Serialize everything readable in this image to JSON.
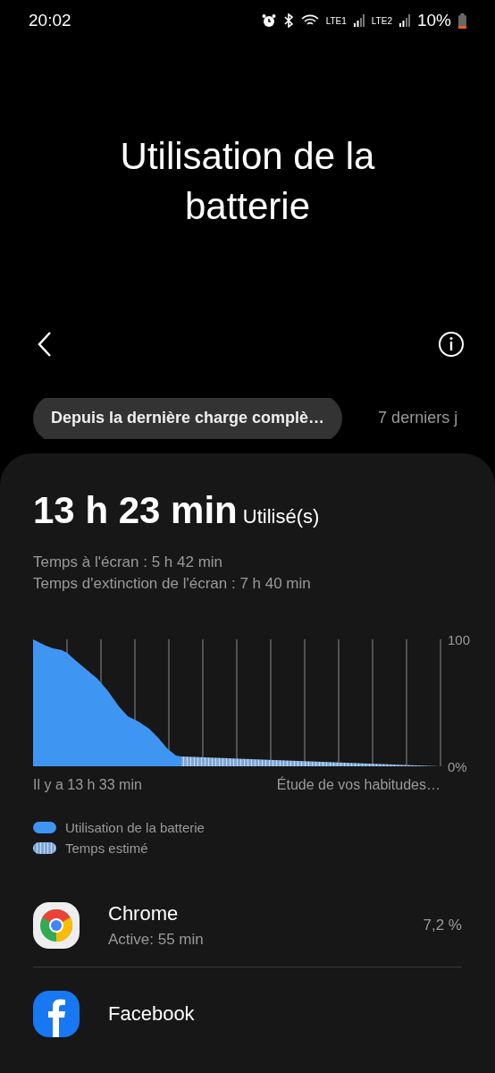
{
  "status_bar": {
    "time": "20:02",
    "network_1": "LTE1",
    "network_2": "LTE2",
    "battery": "10%"
  },
  "title": "Utilisation de la batterie",
  "tabs": [
    {
      "label": "Depuis la dernière charge complè…",
      "selected": true
    },
    {
      "label": "7 derniers j",
      "selected": false
    }
  ],
  "summary": {
    "total": "13 h 23 min",
    "total_label": "Utilisé(s)",
    "lines": [
      "Temps à l'écran : 5 h 42 min",
      "Temps d'extinction de l'écran : 7 h 40 min"
    ]
  },
  "chart": {
    "start_label": "Il y a 13 h 33 min",
    "end_label": "Étude de vos habitudes…",
    "y_top_label": "100",
    "y_bottom_label": "0%",
    "legend": [
      {
        "label": "Utilisation de la batterie",
        "kind": "actual"
      },
      {
        "label": "Temps estimé",
        "kind": "estimate"
      }
    ]
  },
  "apps": [
    {
      "name": "Chrome",
      "detail": "Active: 55 min",
      "percent": "7,2 %",
      "kind": "chrome"
    },
    {
      "name": "Facebook",
      "kind": "facebook"
    }
  ]
}
